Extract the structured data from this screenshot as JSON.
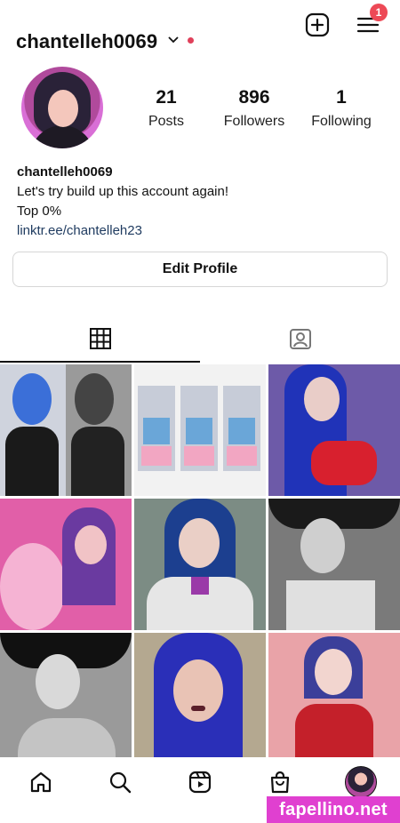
{
  "profile": {
    "username": "chantelleh0069",
    "notification_count": "1",
    "stats": [
      {
        "value": "21",
        "label": "Posts"
      },
      {
        "value": "896",
        "label": "Followers"
      },
      {
        "value": "1",
        "label": "Following"
      }
    ],
    "bio": {
      "name": "chantelleh0069",
      "line1": "Let's try build up this account again!",
      "line2": "Top 0%",
      "link": "linktr.ee/chantelleh23"
    },
    "edit_profile_label": "Edit Profile"
  },
  "tabs": [
    {
      "name": "grid",
      "icon": "grid-icon",
      "active": true
    },
    {
      "name": "tagged",
      "icon": "tagged-person-icon",
      "active": false
    }
  ],
  "posts": [
    {
      "theme": "black-vinyl-blue-hair",
      "colors": [
        "#2a2a2a",
        "#3b6fd8",
        "#f0d6cc"
      ]
    },
    {
      "theme": "triptych-sailor-skirt",
      "colors": [
        "#e9e9e9",
        "#3e6de0",
        "#f2a6c2"
      ]
    },
    {
      "theme": "red-latex-blue-hair",
      "colors": [
        "#4a3a8f",
        "#d8202e",
        "#2033b8"
      ]
    },
    {
      "theme": "pink-teddy-bear",
      "colors": [
        "#e15fa8",
        "#6a3aa0",
        "#f5b3d3"
      ]
    },
    {
      "theme": "schoolgirl-tie",
      "colors": [
        "#7c8c84",
        "#1c3f8f",
        "#e6e6e6"
      ]
    },
    {
      "theme": "monochrome-witch",
      "colors": [
        "#1a1a1a",
        "#7a7a7a",
        "#cfcfcf"
      ]
    },
    {
      "theme": "monochrome-witch-hat",
      "colors": [
        "#111111",
        "#8a8a8a",
        "#d9d9d9"
      ]
    },
    {
      "theme": "red-lips-blue-hair",
      "colors": [
        "#b4a890",
        "#2a2fb8",
        "#e9c3b5"
      ]
    },
    {
      "theme": "clown-red-top",
      "colors": [
        "#e9a3a8",
        "#c4202a",
        "#3b3f9a"
      ]
    }
  ],
  "bottom_nav": [
    {
      "name": "home",
      "icon": "home-icon"
    },
    {
      "name": "search",
      "icon": "search-icon"
    },
    {
      "name": "reels",
      "icon": "reels-icon"
    },
    {
      "name": "shop",
      "icon": "shop-bag-icon"
    },
    {
      "name": "profile",
      "icon": "profile-avatar-icon"
    }
  ],
  "watermark": "fapellino.net"
}
